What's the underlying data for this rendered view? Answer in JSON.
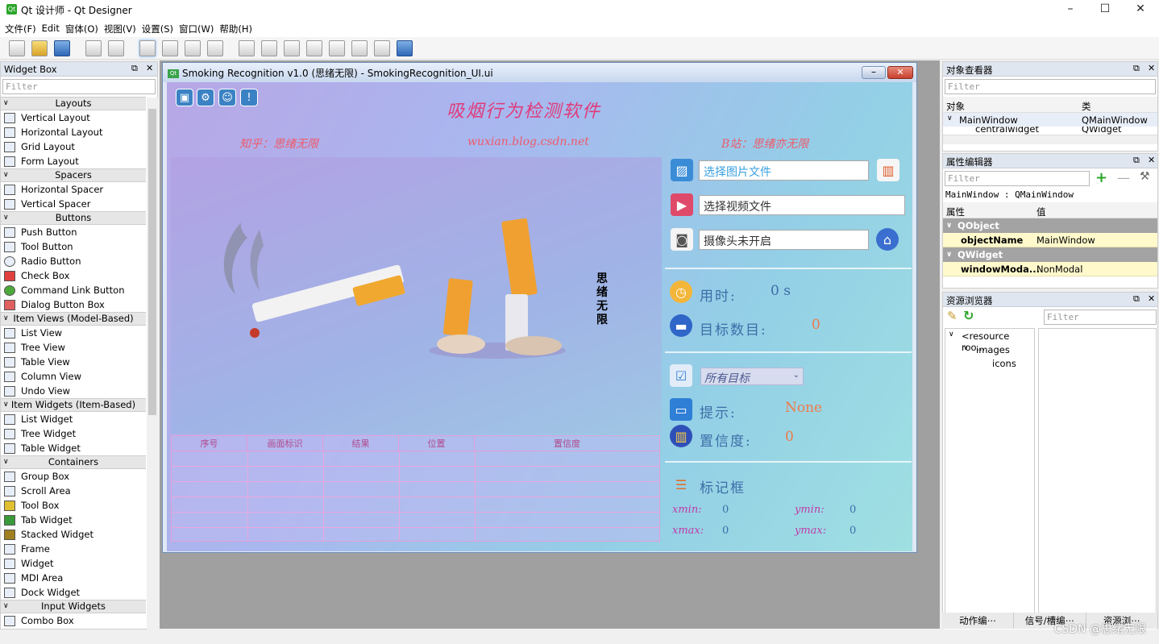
{
  "window": {
    "title": "Qt 设计师 - Qt Designer",
    "app_icon": "qt-designer-icon",
    "min": "–",
    "max": "☐",
    "close": "✕"
  },
  "menu": [
    "文件(F)",
    "Edit",
    "窗体(O)",
    "视图(V)",
    "设置(S)",
    "窗口(W)",
    "帮助(H)"
  ],
  "widget_box": {
    "title": "Widget Box",
    "filter_placeholder": "Filter",
    "categories": [
      {
        "name": "Layouts",
        "items": [
          "Vertical Layout",
          "Horizontal Layout",
          "Grid Layout",
          "Form Layout"
        ]
      },
      {
        "name": "Spacers",
        "items": [
          "Horizontal Spacer",
          "Vertical Spacer"
        ]
      },
      {
        "name": "Buttons",
        "items": [
          "Push Button",
          "Tool Button",
          "Radio Button",
          "Check Box",
          "Command Link Button",
          "Dialog Button Box"
        ]
      },
      {
        "name": "Item Views (Model-Based)",
        "items": [
          "List View",
          "Tree View",
          "Table View",
          "Column View",
          "Undo View"
        ]
      },
      {
        "name": "Item Widgets (Item-Based)",
        "items": [
          "List Widget",
          "Tree Widget",
          "Table Widget"
        ]
      },
      {
        "name": "Containers",
        "items": [
          "Group Box",
          "Scroll Area",
          "Tool Box",
          "Tab Widget",
          "Stacked Widget",
          "Frame",
          "Widget",
          "MDI Area",
          "Dock Widget"
        ]
      },
      {
        "name": "Input Widgets",
        "items": [
          "Combo Box"
        ]
      }
    ]
  },
  "form": {
    "title": "Smoking Recognition v1.0  (思绪无限)   - SmokingRecognition_UI.ui",
    "app_title": "吸烟行为检测软件",
    "subtitle_left": "知乎：思绪无限",
    "subtitle_mid": "wuxian.blog.csdn.net",
    "subtitle_right": "B站：思绪亦无限",
    "vertical_text": "思\n绪\n无\n限",
    "image_file": "选择图片文件",
    "video_file": "选择视频文件",
    "camera": "摄像头未开启",
    "time_label": "用时:",
    "time_value": "0 s",
    "count_label": "目标数目:",
    "count_value": "0",
    "target_select": "所有目标",
    "hint_label": "提示:",
    "hint_value": "None",
    "conf_label": "置信度:",
    "conf_value": "0",
    "box_label": "标记框",
    "xmin_label": "xmin:",
    "xmin": "0",
    "ymin_label": "ymin:",
    "ymin": "0",
    "xmax_label": "xmax:",
    "xmax": "0",
    "ymax_label": "ymax:",
    "ymax": "0",
    "table_headers": [
      "序号",
      "画面标识",
      "结果",
      "位置",
      "置信度"
    ]
  },
  "object_inspector": {
    "title": "对象查看器",
    "filter_placeholder": "Filter",
    "col_object": "对象",
    "col_class": "类",
    "rows": [
      {
        "name": "MainWindow",
        "class": "QMainWindow"
      },
      {
        "name": "centralwidget",
        "class": "QWidget"
      }
    ]
  },
  "property_editor": {
    "title": "属性编辑器",
    "filter_placeholder": "Filter",
    "context": "MainWindow : QMainWindow",
    "col_property": "属性",
    "col_value": "值",
    "groups": [
      {
        "name": "QObject",
        "prop": "objectName",
        "value": "MainWindow"
      },
      {
        "name": "QWidget",
        "prop": "windowModa...",
        "value": "NonModal"
      }
    ]
  },
  "resource_browser": {
    "title": "资源浏览器",
    "filter_placeholder": "Filter",
    "tree": [
      "<resource roo...",
      "images",
      "icons"
    ]
  },
  "bottom_tabs": [
    "动作编⋯",
    "信号/槽编⋯",
    "资源浏⋯"
  ],
  "watermark": "CSDN @思绪无限"
}
